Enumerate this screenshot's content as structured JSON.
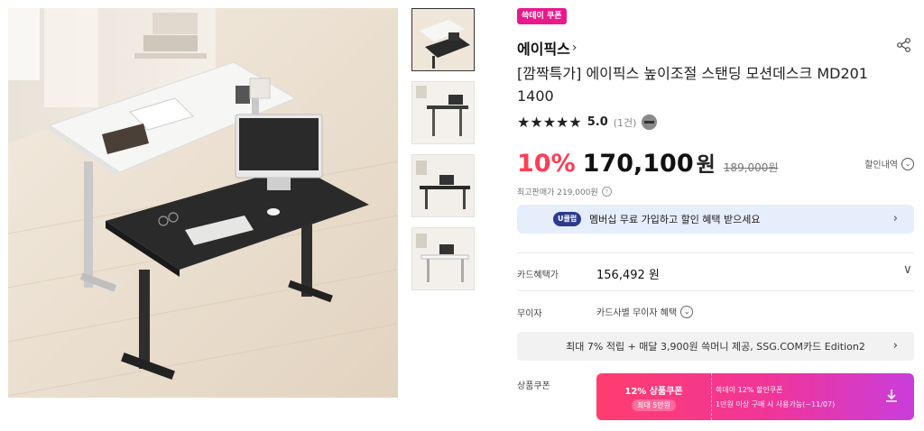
{
  "product": {
    "badge": "쓱데이 쿠폰",
    "brand": "에이픽스",
    "brand_chevron": "›",
    "title": "[깜짝특가] 에이픽스 높이조절 스탠딩 모션데스크 MD201 1400",
    "rating": {
      "stars": "★★★★★",
      "score": "5.0",
      "count": "(1건)"
    },
    "price": {
      "discount_rate": "10%",
      "sale_price": "170,100",
      "currency": "원",
      "original_price": "189,000원",
      "max_price_label": "최고판매가 219,000원",
      "question_glyph": "?"
    },
    "discount_detail_label": "할인내역",
    "chevron_down_glyph": "⌄"
  },
  "uclub": {
    "badge": "U클럽",
    "text": "멤버십 무료 가입하고 할인 혜택 받으세요",
    "arrow": "›"
  },
  "card_benefit": {
    "label": "카드혜택가",
    "price": "156,492 원",
    "chevron": "∨"
  },
  "no_interest": {
    "label": "무이자",
    "text": "카드사별 무이자 혜택"
  },
  "ssg_banner": {
    "text": "최대 7% 적립 + 매달 3,900원 쓱머니 제공, SSG.COM카드 Edition2",
    "arrow": "›"
  },
  "coupon": {
    "label": "상품쿠폰",
    "title": "12% 상품쿠폰",
    "max": "최대 5만원",
    "line1": "쓱데이 12% 할인쿠폰",
    "line2": "1만원 이상 구매 시 사용가능(~11/07)"
  },
  "thumbnails": [
    {
      "alt": "desk-photo-1",
      "active": true
    },
    {
      "alt": "desk-photo-2",
      "active": false
    },
    {
      "alt": "desk-photo-3",
      "active": false
    },
    {
      "alt": "desk-photo-4",
      "active": false
    }
  ],
  "colors": {
    "accent_pink": "#e8198b",
    "discount_red": "#ff3e55",
    "uclub_bg": "#e6edfb"
  }
}
